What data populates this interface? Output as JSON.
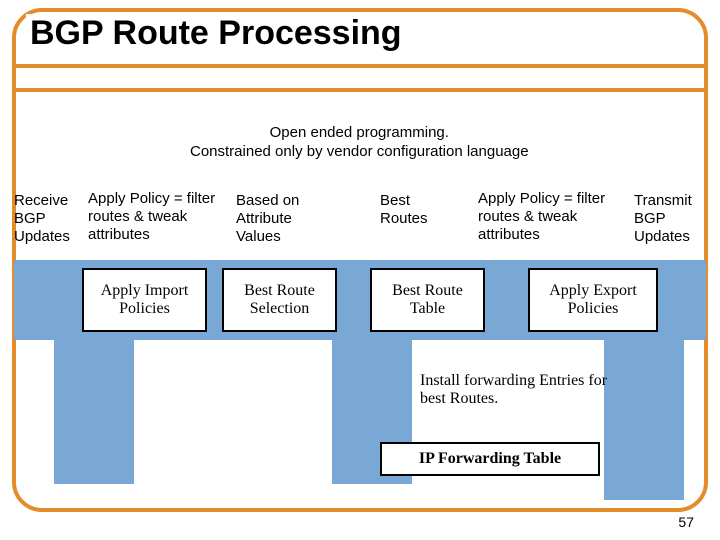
{
  "title": "BGP Route Processing",
  "caption": {
    "line1": "Open ended programming.",
    "line2": "Constrained only by vendor configuration language"
  },
  "top_labels": {
    "receive": "Receive BGP Updates",
    "apply_left": "Apply Policy = filter routes & tweak attributes",
    "based": "Based on Attribute Values",
    "best": "Best Routes",
    "apply_right": "Apply Policy = filter routes & tweak attributes",
    "transmit": "Transmit BGP Updates"
  },
  "stages": {
    "s1": "Apply Import Policies",
    "s2": "Best Route Selection",
    "s3": "Best Route Table",
    "s4": "Apply Export Policies"
  },
  "install_text": "Install forwarding Entries for best Routes.",
  "ip_fwd": "IP Forwarding Table",
  "page_number": "57"
}
